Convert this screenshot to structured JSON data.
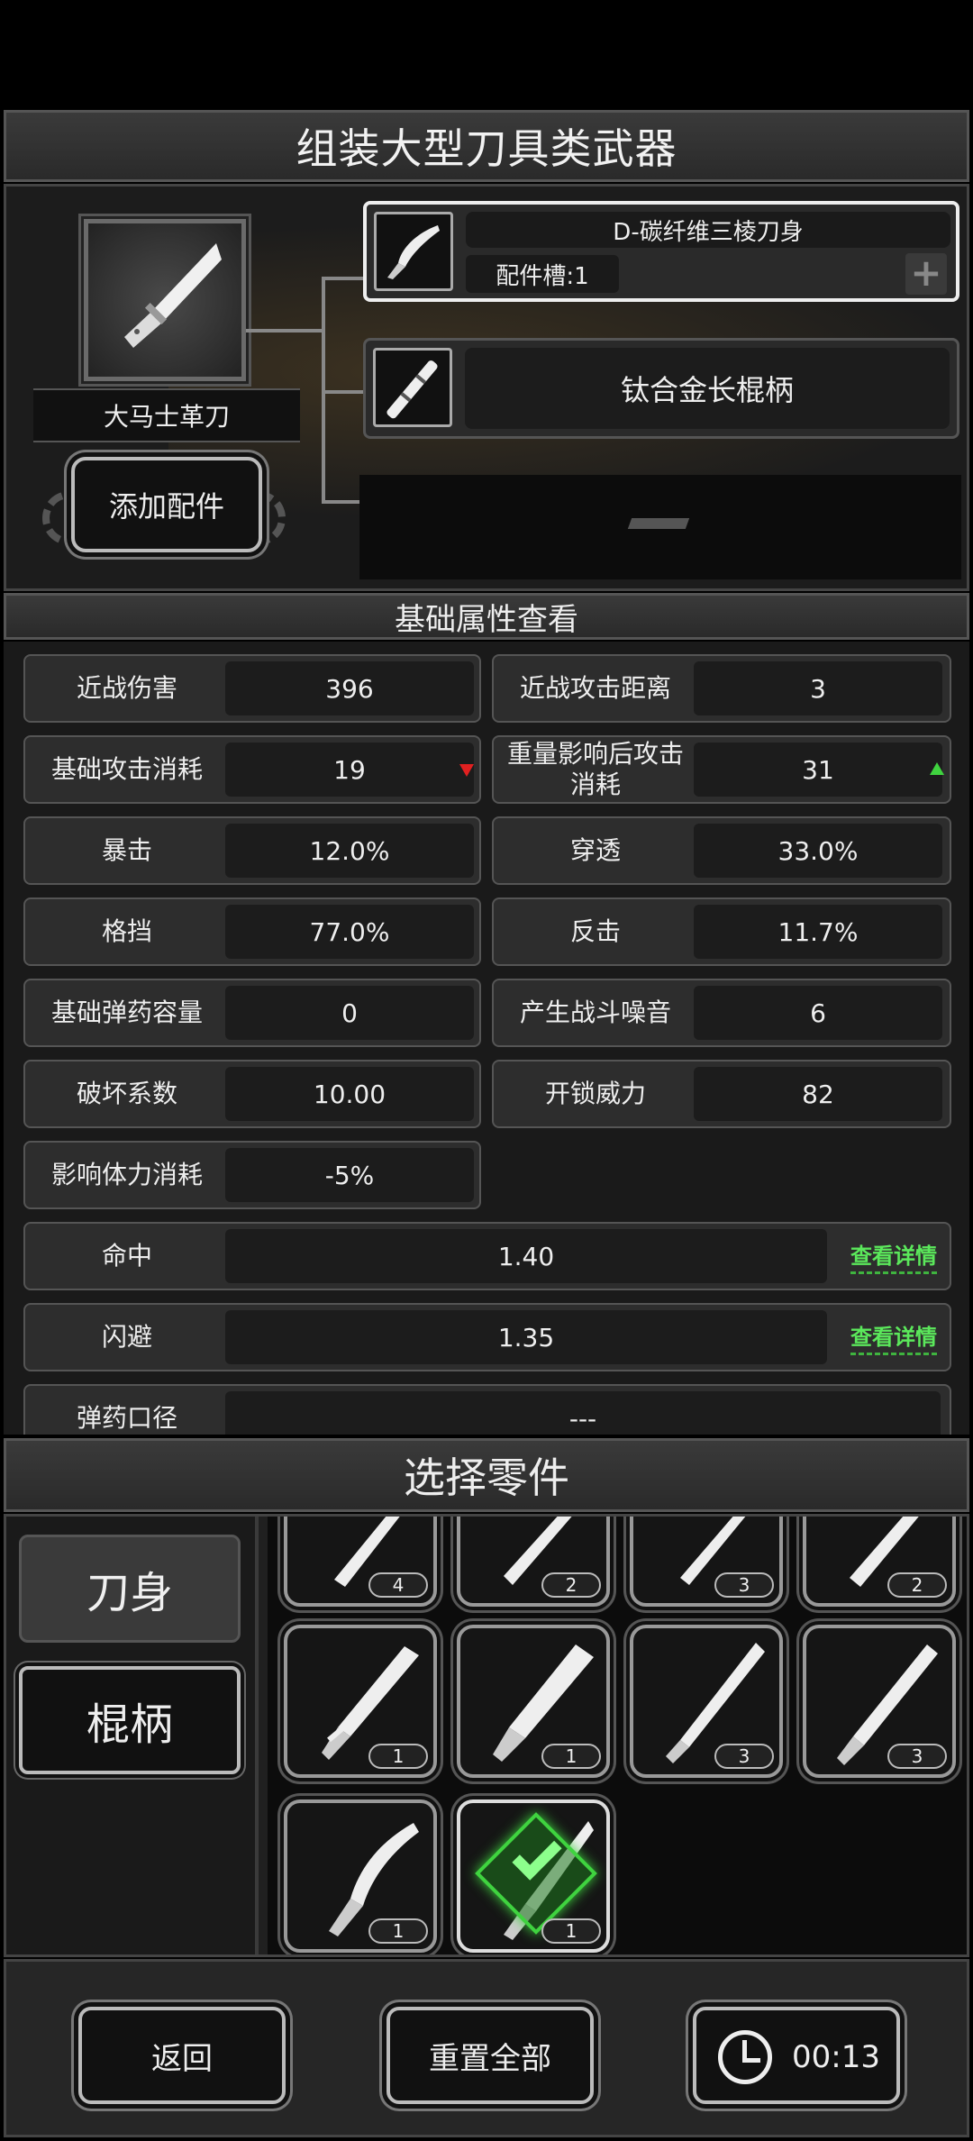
{
  "title": "组装大型刀具类武器",
  "weapon": {
    "name": "大马士革刀",
    "add_part_label": "添加配件"
  },
  "slots": [
    {
      "name": "D-碳纤维三棱刀身",
      "sub": "配件槽:1",
      "plus": "+"
    },
    {
      "name": "钛合金长棍柄"
    }
  ],
  "stats_title": "基础属性查看",
  "stats": {
    "melee_damage": {
      "label": "近战伤害",
      "value": "396"
    },
    "melee_range": {
      "label": "近战攻击距离",
      "value": "3"
    },
    "base_attack_cost": {
      "label": "基础攻击消耗",
      "value": "19",
      "trend": "down"
    },
    "weighted_attack_cost": {
      "label": "重量影响后攻击消耗",
      "value": "31",
      "trend": "up"
    },
    "crit": {
      "label": "暴击",
      "value": "12.0%"
    },
    "penetration": {
      "label": "穿透",
      "value": "33.0%"
    },
    "block": {
      "label": "格挡",
      "value": "77.0%"
    },
    "counter": {
      "label": "反击",
      "value": "11.7%"
    },
    "ammo_capacity": {
      "label": "基础弹药容量",
      "value": "0"
    },
    "noise": {
      "label": "产生战斗噪音",
      "value": "6"
    },
    "destruction": {
      "label": "破坏系数",
      "value": "10.00"
    },
    "unlock_power": {
      "label": "开锁威力",
      "value": "82"
    },
    "stamina": {
      "label": "影响体力消耗",
      "value": "-5%"
    },
    "accuracy": {
      "label": "命中",
      "value": "1.40",
      "link": "查看详情"
    },
    "evasion": {
      "label": "闪避",
      "value": "1.35",
      "link": "查看详情"
    },
    "caliber": {
      "label": "弹药口径",
      "value": "---"
    }
  },
  "select_title": "选择零件",
  "categories": [
    {
      "label": "刀身",
      "selected": true
    },
    {
      "label": "棍柄",
      "selected": false
    }
  ],
  "items": {
    "row1": [
      "4",
      "2",
      "3",
      "2"
    ],
    "row2": [
      "1",
      "1",
      "3",
      "3"
    ],
    "row3": [
      "1",
      "1"
    ]
  },
  "bottom": {
    "back": "返回",
    "reset": "重置全部",
    "timer": "00:13"
  },
  "colors": {
    "accent_green": "#3fd33f",
    "down_red": "#e02020"
  }
}
